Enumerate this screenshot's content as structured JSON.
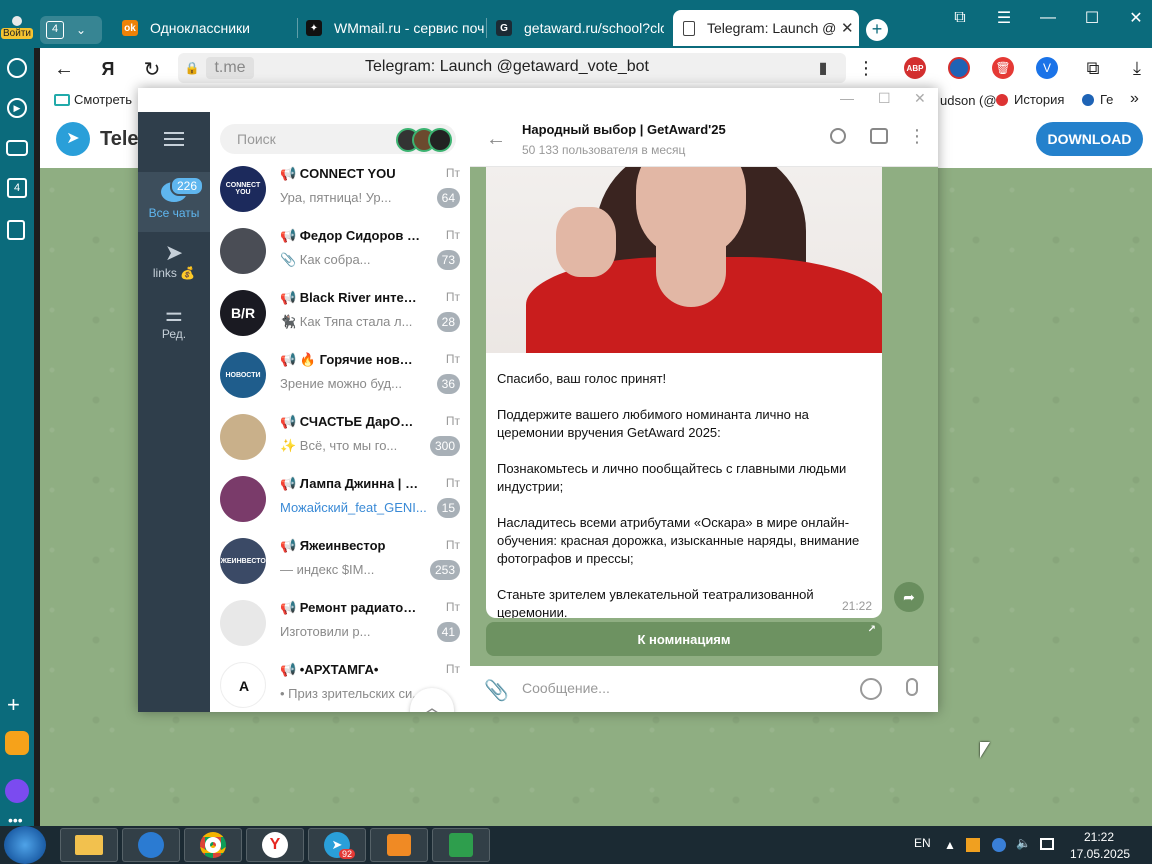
{
  "browser": {
    "tab_count": "4",
    "login_label": "Войти",
    "tabs": [
      {
        "label": "Одноклассники"
      },
      {
        "label": "WMmail.ru - сервис поч"
      },
      {
        "label": "getaward.ru/school?clck"
      },
      {
        "label": "Telegram: Launch @g"
      }
    ],
    "address_host": "t.me",
    "page_title": "Telegram: Launch @getaward_vote_bot",
    "bookmarks": {
      "left": "Смотреть",
      "right_partial": "udson (@",
      "history": "История",
      "last": "Ге"
    },
    "ext_abp": "ABP"
  },
  "page": {
    "logo_text": "Tele",
    "download_label": "DOWNLOAD"
  },
  "tg": {
    "rail": {
      "all_chats_label": "Все чаты",
      "all_chats_badge": "226",
      "links_label": "links 💰",
      "edit_label": "Ред."
    },
    "search_placeholder": "Поиск",
    "chats": [
      {
        "name": "📢 CONNECT YOU",
        "time": "Пт",
        "preview": "Ура, пятница! Ур...",
        "badge": "64",
        "ava_text": "CONNECT YOU",
        "ava_color": "#1c2a5c"
      },
      {
        "name": "📢 Федор Сидоров | И...",
        "time": "Пт",
        "preview": "📎 Как собра...",
        "badge": "73",
        "ava_text": "",
        "ava_color": "#4a4d55"
      },
      {
        "name": "📢 Black River интерне...",
        "time": "Пт",
        "preview": "🐈‍⬛ Как Тяпа стала л...",
        "badge": "28",
        "ava_text": "B/R",
        "ava_color": "#1a1a22"
      },
      {
        "name": "📢 🔥 Горячие новост...",
        "time": "Пт",
        "preview": "Зрение можно буд...",
        "badge": "36",
        "ava_text": "НОВОСТИ",
        "ava_color": "#1f5d8c"
      },
      {
        "name": "📢 СЧАСТЬЕ ДарОМ ОК...",
        "time": "Пт",
        "preview": "✨ Всё, что мы го...",
        "badge": "300",
        "ava_text": "",
        "ava_color": "#c9b08a"
      },
      {
        "name": "📢 Лампа Джинна | GE...",
        "time": "Пт",
        "preview": "Можайский_feat_GENI...",
        "badge": "15",
        "ava_text": "",
        "ava_color": "#7a3b6a"
      },
      {
        "name": "📢 Яжеинвестор",
        "time": "Пт",
        "preview": "— индекс $IM...",
        "badge": "253",
        "ava_text": "ЯЖЕИНВЕСТОР",
        "ava_color": "#3b4a66"
      },
      {
        "name": "📢 Ремонт радиатора ...",
        "time": "Пт",
        "preview": "Изготовили р...",
        "badge": "41",
        "ava_text": "",
        "ava_color": "#e8e8e8"
      },
      {
        "name": "📢 •АРХТАМГА•",
        "time": "Пт",
        "preview": "• Приз зрительских си...",
        "badge": "",
        "ava_text": "A",
        "ava_color": "#ffffff"
      }
    ],
    "chat": {
      "title": "Народный выбор | GetAward'25",
      "subtitle": "50 133 пользователя в месяц",
      "message": "Спасибо, ваш голос принят!\n\nПоддержите вашего любимого номинанта лично на церемонии вручения GetAward 2025:\n\nПознакомьтесь и лично пообщайтесь с главными людьми индустрии;\n\nНасладитесь всеми атрибутами «Оскара» в мире онлайн-обучения: красная дорожка, изысканные наряды, внимание фотографов и прессы;\n\nСтаньте зрителем увлекательной театрализованной церемонии.",
      "time": "21:22",
      "button_label": "К номинациям",
      "composer_placeholder": "Сообщение..."
    }
  },
  "taskbar": {
    "lang": "EN",
    "time": "21:22",
    "date": "17.05.2025",
    "telegram_badge": "92"
  },
  "colors": {
    "browser_teal": "#0b6b7c",
    "tg_blue": "#2481cc",
    "tg_rail": "#2f3e4b",
    "chat_bg": "#8fae82"
  }
}
